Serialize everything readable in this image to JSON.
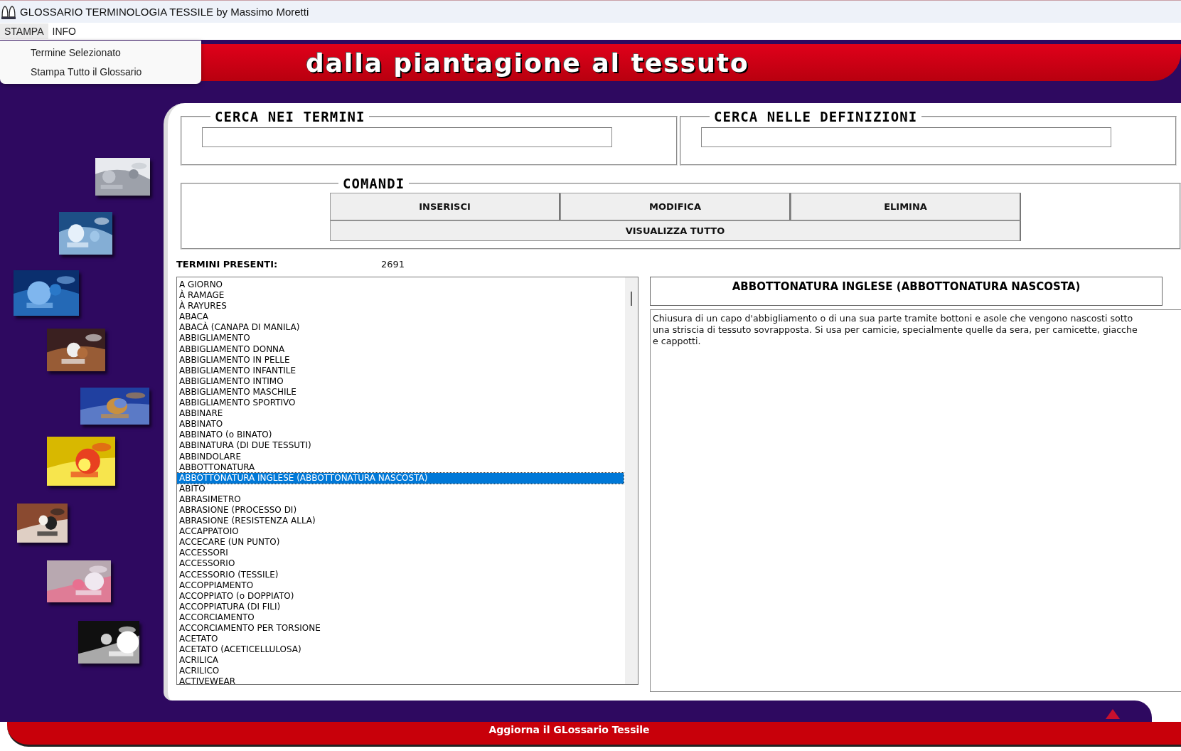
{
  "window": {
    "title": "GLOSSARIO TERMINOLOGIA TESSILE by Massimo Moretti"
  },
  "menu_bar": [
    {
      "label": "STAMPA",
      "selected": true
    },
    {
      "label": "INFO",
      "selected": false
    }
  ],
  "open_menu": {
    "items": [
      "Termine Selezionato",
      "Stampa Tutto il Glossario"
    ]
  },
  "banner": {
    "tagline": "dalla piantagione al tessuto"
  },
  "search_groups": [
    {
      "title": "CERCA NEI TERMINI"
    },
    {
      "title": "CERCA NELLE DEFINIZIONI"
    }
  ],
  "commands": {
    "title": "COMANDI",
    "buttons": [
      "INSERISCI",
      "MODIFICA",
      "ELIMINA"
    ],
    "wide_button": "VISUALIZZA TUTTO"
  },
  "term_count": {
    "label": "TERMINI PRESENTI:",
    "value": "2691"
  },
  "terms": [
    {
      "label": "A GIORNO",
      "selected": false
    },
    {
      "label": "À RAMAGE",
      "selected": false
    },
    {
      "label": "À RAYURES",
      "selected": false
    },
    {
      "label": "ABACA",
      "selected": false
    },
    {
      "label": "ABACÀ (CANAPA DI MANILA)",
      "selected": false
    },
    {
      "label": "ABBIGLIAMENTO",
      "selected": false
    },
    {
      "label": "ABBIGLIAMENTO DONNA",
      "selected": false
    },
    {
      "label": "ABBIGLIAMENTO IN PELLE",
      "selected": false
    },
    {
      "label": "ABBIGLIAMENTO INFANTILE",
      "selected": false
    },
    {
      "label": "ABBIGLIAMENTO INTIMO",
      "selected": false
    },
    {
      "label": "ABBIGLIAMENTO MASCHILE",
      "selected": false
    },
    {
      "label": "ABBIGLIAMENTO SPORTIVO",
      "selected": false
    },
    {
      "label": "ABBINARE",
      "selected": false
    },
    {
      "label": "ABBINATO",
      "selected": false
    },
    {
      "label": "ABBINATO (o BINATO)",
      "selected": false
    },
    {
      "label": "ABBINATURA (DI DUE TESSUTI)",
      "selected": false
    },
    {
      "label": "ABBINDOLARE",
      "selected": false
    },
    {
      "label": "ABBOTTONATURA",
      "selected": false
    },
    {
      "label": "ABBOTTONATURA INGLESE (ABBOTTONATURA NASCOSTA)",
      "selected": true
    },
    {
      "label": "ABITO",
      "selected": false
    },
    {
      "label": "ABRASIMETRO",
      "selected": false
    },
    {
      "label": "ABRASIONE (PROCESSO DI)",
      "selected": false
    },
    {
      "label": "ABRASIONE (RESISTENZA ALLA)",
      "selected": false
    },
    {
      "label": "ACCAPPATOIO",
      "selected": false
    },
    {
      "label": "ACCECARE (UN PUNTO)",
      "selected": false
    },
    {
      "label": "ACCESSORI",
      "selected": false
    },
    {
      "label": "ACCESSORIO",
      "selected": false
    },
    {
      "label": "ACCESSORIO (TESSILE)",
      "selected": false
    },
    {
      "label": "ACCOPPIAMENTO",
      "selected": false
    },
    {
      "label": "ACCOPPIATO (o DOPPIATO)",
      "selected": false
    },
    {
      "label": "ACCOPPIATURA (DI FILI)",
      "selected": false
    },
    {
      "label": "ACCORCIAMENTO",
      "selected": false
    },
    {
      "label": "ACCORCIAMENTO PER TORSIONE",
      "selected": false
    },
    {
      "label": "ACETATO",
      "selected": false
    },
    {
      "label": "ACETATO (ACETICELLULOSA)",
      "selected": false
    },
    {
      "label": "ACRILICA",
      "selected": false
    },
    {
      "label": "ACRILICO",
      "selected": false
    },
    {
      "label": "ACTIVEWEAR",
      "selected": false
    }
  ],
  "definition": {
    "title": "ABBOTTONATURA INGLESE (ABBOTTONATURA NASCOSTA)",
    "text": "Chiusura di un capo d'abbigliamento o di una sua parte tramite bottoni e asole che vengono nascosti sotto una striscia di tessuto sovrapposta. Si usa per camicie, specialmente quelle da sera, per camicette, giacche e cappotti."
  },
  "footer": {
    "link": "Aggiorna il GLossario Tessile"
  }
}
